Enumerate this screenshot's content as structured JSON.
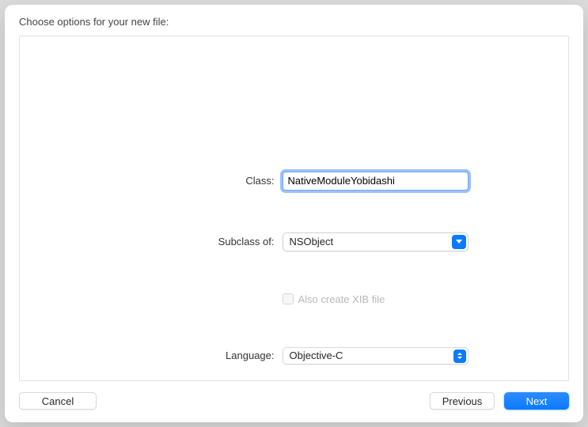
{
  "heading": "Choose options for your new file:",
  "form": {
    "class_label": "Class:",
    "class_value": "NativeModuleYobidashi",
    "subclass_label": "Subclass of:",
    "subclass_value": "NSObject",
    "xib_label": "Also create XIB file",
    "language_label": "Language:",
    "language_value": "Objective-C"
  },
  "buttons": {
    "cancel": "Cancel",
    "previous": "Previous",
    "next": "Next"
  }
}
